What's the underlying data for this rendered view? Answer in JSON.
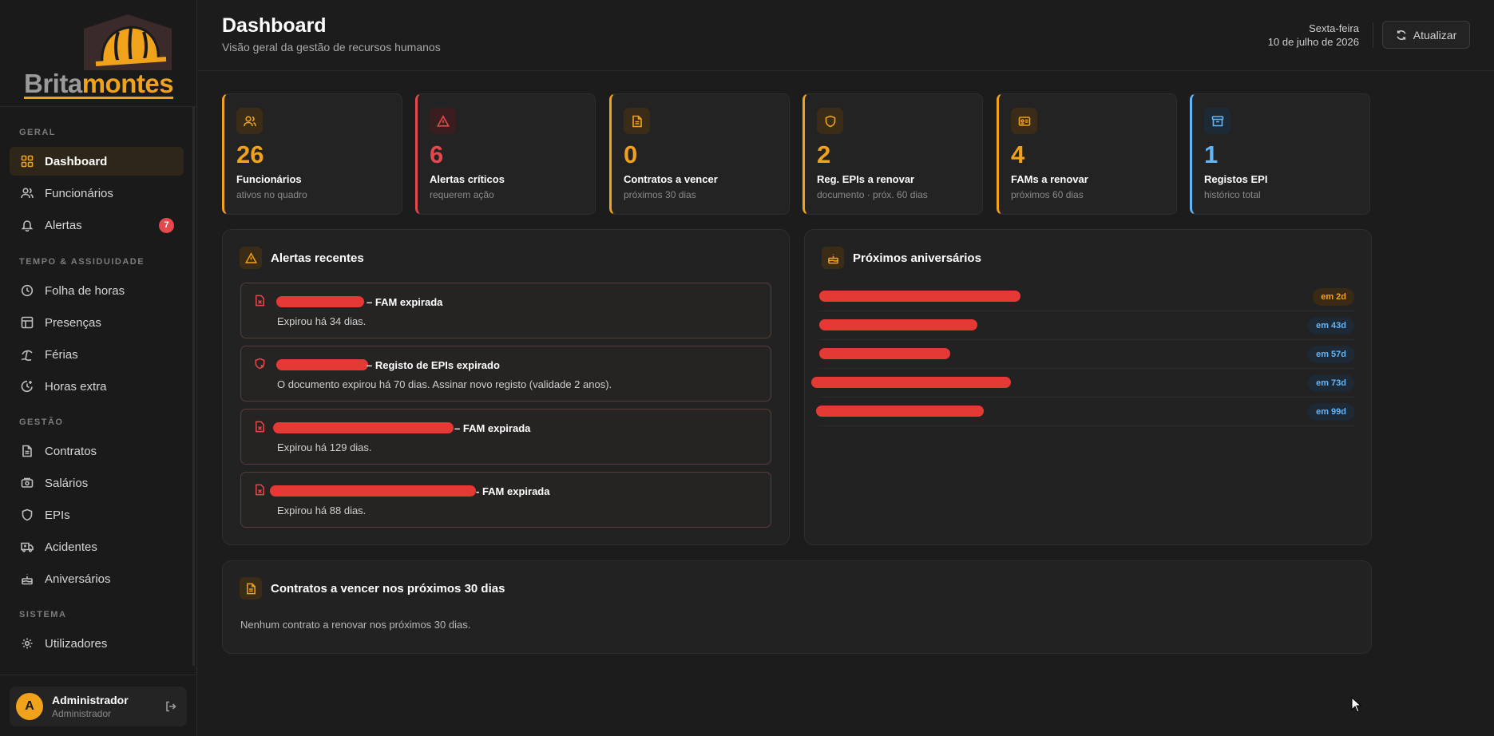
{
  "brand": {
    "part1": "Brita",
    "part2": "montes"
  },
  "sidebar": {
    "sections": [
      {
        "label": "GERAL"
      },
      {
        "label": "TEMPO & ASSIDUIDADE"
      },
      {
        "label": "GESTÃO"
      },
      {
        "label": "SISTEMA"
      }
    ],
    "items": [
      {
        "label": "Dashboard",
        "icon": "grid-icon"
      },
      {
        "label": "Funcionários",
        "icon": "users-icon"
      },
      {
        "label": "Alertas",
        "icon": "bell-icon",
        "badge": "7"
      },
      {
        "label": "Folha de horas",
        "icon": "clock-icon"
      },
      {
        "label": "Presenças",
        "icon": "table-icon"
      },
      {
        "label": "Férias",
        "icon": "beach-icon"
      },
      {
        "label": "Horas extra",
        "icon": "clock-plus-icon"
      },
      {
        "label": "Contratos",
        "icon": "document-icon"
      },
      {
        "label": "Salários",
        "icon": "money-icon"
      },
      {
        "label": "EPIs",
        "icon": "shield-icon"
      },
      {
        "label": "Acidentes",
        "icon": "ambulance-icon"
      },
      {
        "label": "Aniversários",
        "icon": "cake-icon"
      },
      {
        "label": "Utilizadores",
        "icon": "gear-icon"
      }
    ],
    "user": {
      "initial": "A",
      "name": "Administrador",
      "role": "Administrador"
    }
  },
  "header": {
    "title": "Dashboard",
    "subtitle": "Visão geral da gestão de recursos humanos",
    "day": "Sexta-feira",
    "date": "10 de julho de 2026",
    "refresh_label": "Atualizar"
  },
  "stats": [
    {
      "value": "26",
      "label": "Funcionários",
      "sub": "ativos no quadro",
      "color": "#f0a21b"
    },
    {
      "value": "6",
      "label": "Alertas críticos",
      "sub": "requerem ação",
      "color": "#e5484d"
    },
    {
      "value": "0",
      "label": "Contratos a vencer",
      "sub": "próximos 30 dias",
      "color": "#f0a21b"
    },
    {
      "value": "2",
      "label": "Reg. EPIs a renovar",
      "sub": "documento · próx. 60 dias",
      "color": "#f0a21b"
    },
    {
      "value": "4",
      "label": "FAMs a renovar",
      "sub": "próximos 60 dias",
      "color": "#f0a21b"
    },
    {
      "value": "1",
      "label": "Registos EPI",
      "sub": "histórico total",
      "color": "#64b5f6"
    }
  ],
  "alerts": {
    "title": "Alertas recentes",
    "items": [
      {
        "title": "– FAM expirada",
        "desc": "Expirou há 34 dias."
      },
      {
        "title": "– Registo de EPIs expirado",
        "desc": "O documento expirou há 70 dias. Assinar novo registo (validade 2 anos)."
      },
      {
        "title": "– FAM expirada",
        "desc": "Expirou há 129 dias."
      },
      {
        "title": "- FAM expirada",
        "desc": "Expirou há 88 dias."
      }
    ]
  },
  "birthdays": {
    "title": "Próximos aniversários",
    "items": [
      {
        "when": "em 2d",
        "tone": "orange"
      },
      {
        "when": "em 43d",
        "tone": "blue"
      },
      {
        "when": "em 57d",
        "tone": "blue"
      },
      {
        "when": "em 73d",
        "tone": "blue"
      },
      {
        "when": "em 99d",
        "tone": "blue"
      }
    ]
  },
  "contracts": {
    "title": "Contratos a vencer nos próximos 30 dias",
    "empty": "Nenhum contrato a renovar nos próximos 30 dias."
  }
}
